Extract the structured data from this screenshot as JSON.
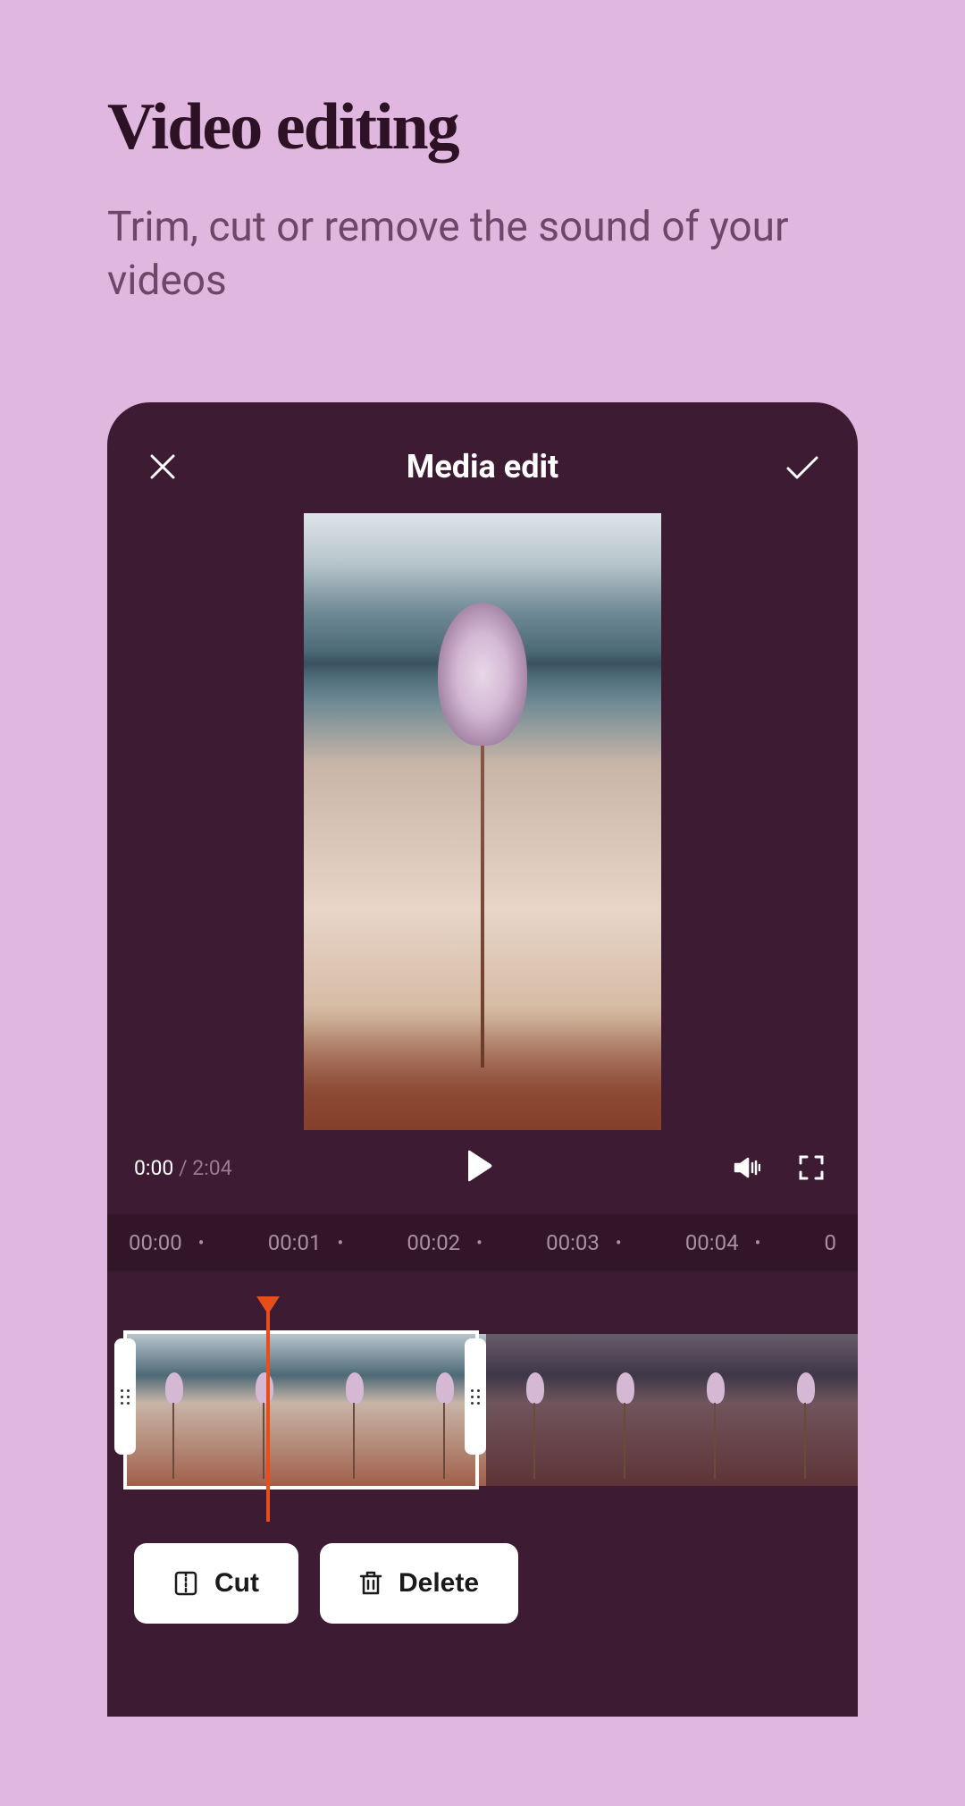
{
  "marketing": {
    "title": "Video editing",
    "subtitle": "Trim, cut or remove the sound of your videos"
  },
  "editor": {
    "header_title": "Media edit",
    "time_current": "0:00",
    "time_separator": " / ",
    "time_total": "2:04",
    "ruler_marks": [
      "00:00",
      "00:01",
      "00:02",
      "00:03",
      "00:04",
      "0"
    ],
    "actions": {
      "cut_label": "Cut",
      "delete_label": "Delete"
    }
  }
}
